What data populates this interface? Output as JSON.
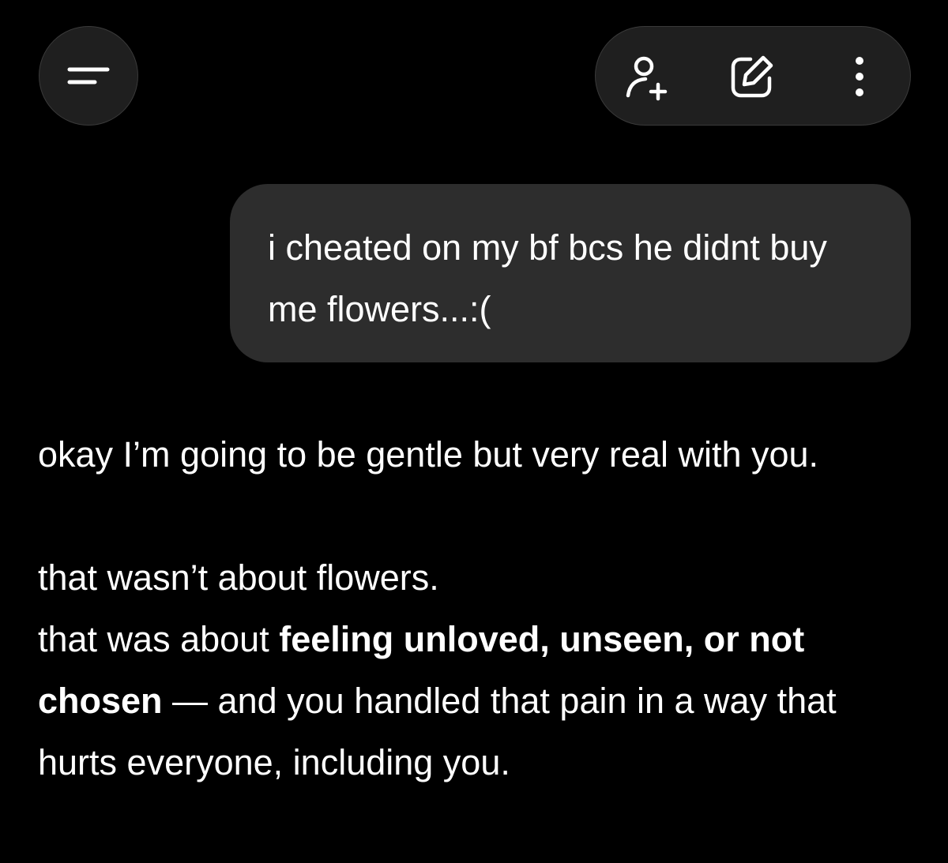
{
  "header": {
    "menu_icon": "sidebar-menu-icon",
    "actions": [
      {
        "icon": "add-person-icon"
      },
      {
        "icon": "new-chat-edit-icon"
      },
      {
        "icon": "more-vertical-icon"
      }
    ]
  },
  "conversation": {
    "user_message": "i cheated on my bf bcs he didnt buy me flowers...:(",
    "assistant": {
      "para1": "okay I’m going to be gentle but very real with you.",
      "para2_line1": "that wasn’t about flowers.",
      "para2_line2_pre": "that was about ",
      "para2_line2_bold": "feeling unloved, unseen, or not chosen",
      "para2_line2_post": " — and you handled that pain in a way that hurts everyone, including you."
    }
  },
  "colors": {
    "background": "#000000",
    "bubble": "#2d2d2d",
    "header_button": "#1f1f1f",
    "text": "#ffffff"
  }
}
